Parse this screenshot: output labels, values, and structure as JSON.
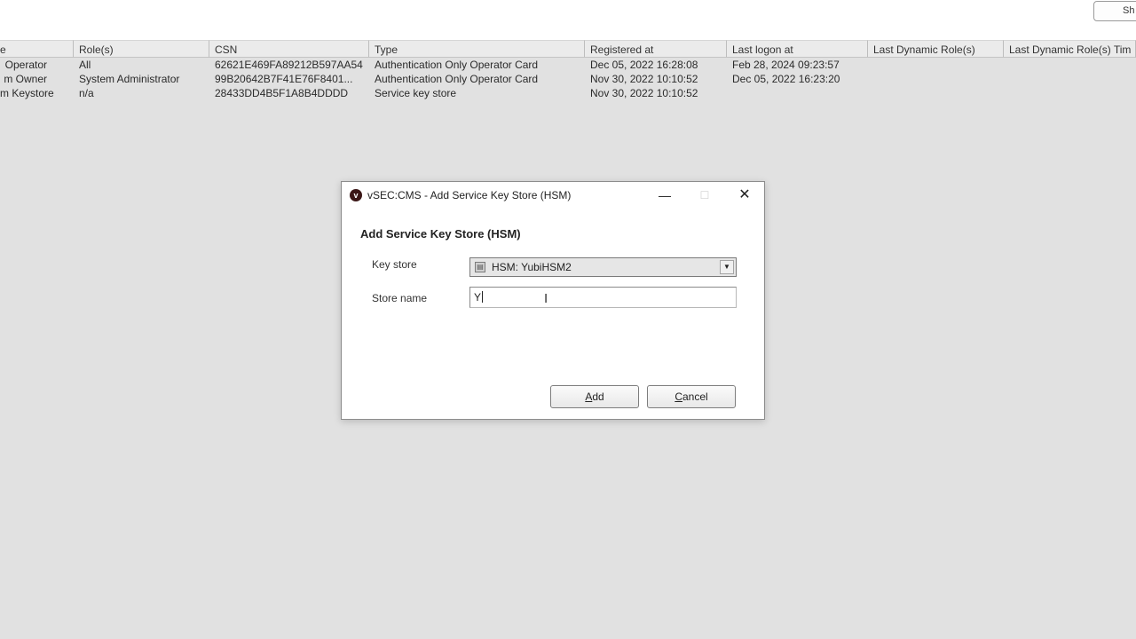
{
  "topbar": {
    "button_label": "Sh"
  },
  "table": {
    "headers": [
      "e",
      "Role(s)",
      "CSN",
      "Type",
      "Registered at",
      "Last logon at",
      "Last Dynamic Role(s)",
      "Last Dynamic Role(s) Tim"
    ],
    "rows": [
      [
        "Operator",
        "All",
        "62621E469FA89212B597AA54",
        "Authentication Only Operator Card",
        "Dec 05, 2022 16:28:08",
        "Feb 28, 2024 09:23:57",
        "",
        ""
      ],
      [
        "m Owner",
        "System Administrator",
        "99B20642B7F41E76F8401...",
        "Authentication Only Operator Card",
        "Nov 30, 2022 10:10:52",
        "Dec 05, 2022 16:23:20",
        "",
        ""
      ],
      [
        "m Keystore",
        "n/a",
        "28433DD4B5F1A8B4DDDD",
        "Service key store",
        "Nov 30, 2022 10:10:52",
        "",
        "",
        ""
      ]
    ]
  },
  "dialog": {
    "app_icon_letter": "v",
    "title": "vSEC:CMS - Add Service Key Store (HSM)",
    "minimize_glyph": "—",
    "maximize_glyph": "☐",
    "close_glyph": "✕",
    "heading": "Add Service Key Store (HSM)",
    "key_store_label": "Key store",
    "key_store_value": "HSM: YubiHSM2",
    "store_name_label": "Store name",
    "store_name_value": "Y",
    "add_hotkey": "A",
    "add_rest": "dd",
    "cancel_hotkey": "C",
    "cancel_rest": "ancel"
  }
}
